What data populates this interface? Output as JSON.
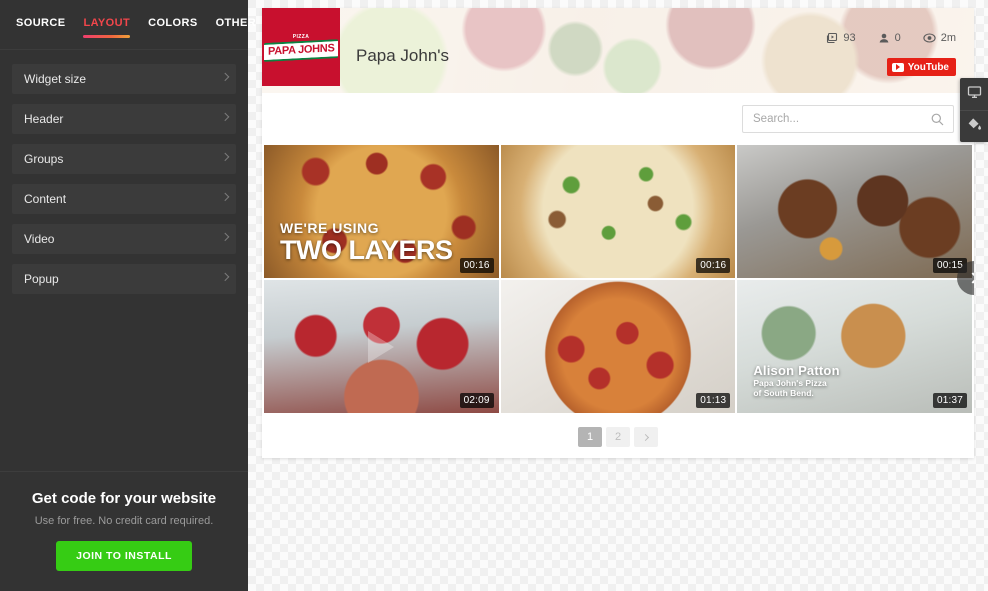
{
  "sidebar": {
    "tabs": [
      {
        "label": "SOURCE",
        "active": false
      },
      {
        "label": "LAYOUT",
        "active": true
      },
      {
        "label": "COLORS",
        "active": false
      },
      {
        "label": "OTHER",
        "active": false
      }
    ],
    "panels": [
      {
        "label": "Widget size"
      },
      {
        "label": "Header"
      },
      {
        "label": "Groups"
      },
      {
        "label": "Content"
      },
      {
        "label": "Video"
      },
      {
        "label": "Popup"
      }
    ],
    "cta": {
      "title": "Get code for your website",
      "subtitle": "Use for free. No credit card required.",
      "button": "JOIN TO INSTALL"
    }
  },
  "widget": {
    "header": {
      "logo_pizza": "PIZZA",
      "logo_name": "PAPA JOHNS",
      "channel_title": "Papa John's",
      "stats": [
        {
          "icon": "videos-icon",
          "value": "93"
        },
        {
          "icon": "subscribers-icon",
          "value": "0"
        },
        {
          "icon": "views-icon",
          "value": "2m"
        }
      ],
      "youtube_badge": "YouTube"
    },
    "search": {
      "placeholder": "Search...",
      "value": "",
      "icon": "search-icon"
    },
    "videos": [
      {
        "art": "t1",
        "duration": "00:16",
        "caption_small": "WE'RE USING",
        "caption_large": "TWO LAYERS"
      },
      {
        "art": "t2",
        "duration": "00:16"
      },
      {
        "art": "t3",
        "duration": "00:15"
      },
      {
        "art": "t4",
        "duration": "02:09"
      },
      {
        "art": "t5",
        "duration": "01:13"
      },
      {
        "art": "t6",
        "duration": "01:37",
        "caption_name": "Alison Patton",
        "caption_sub": "Papa John's Pizza\nof South Bend."
      }
    ],
    "next_arrow_icon": "chevron-right-icon",
    "pagination": {
      "pages": [
        {
          "label": "1",
          "active": true
        },
        {
          "label": "2",
          "active": false
        }
      ],
      "next_icon": "chevron-right-icon"
    }
  },
  "tools": [
    {
      "icon": "monitor-icon"
    },
    {
      "icon": "paint-bucket-icon"
    }
  ],
  "colors": {
    "sidebar_bg": "#333333",
    "accent_red": "#f2464b",
    "cta_green": "#36cc14",
    "brand_red": "#c8102e",
    "youtube_red": "#e62117"
  }
}
